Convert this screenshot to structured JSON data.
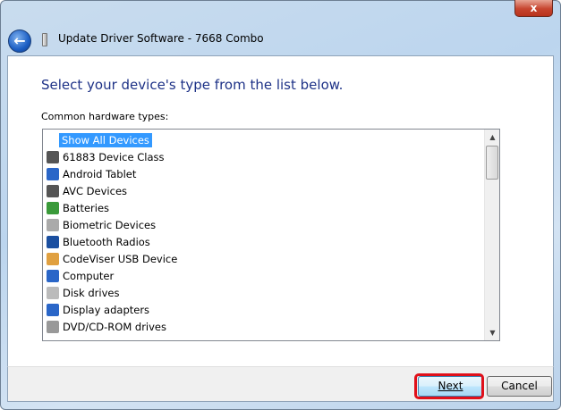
{
  "window": {
    "title": "Update Driver Software - 7668 Combo",
    "close_label": "x"
  },
  "heading": "Select your device's type from the list below.",
  "list_label": "Common hardware types:",
  "items": [
    {
      "label": "Show All Devices",
      "icon": "none",
      "selected": true
    },
    {
      "label": "61883 Device Class",
      "icon": "usb-plug-icon"
    },
    {
      "label": "Android Tablet",
      "icon": "monitor-icon"
    },
    {
      "label": "AVC Devices",
      "icon": "usb-plug-icon"
    },
    {
      "label": "Batteries",
      "icon": "battery-icon"
    },
    {
      "label": "Biometric Devices",
      "icon": "fingerprint-icon"
    },
    {
      "label": "Bluetooth Radios",
      "icon": "bluetooth-icon"
    },
    {
      "label": "CodeViser USB Device",
      "icon": "gear-icon"
    },
    {
      "label": "Computer",
      "icon": "computer-icon"
    },
    {
      "label": "Disk drives",
      "icon": "disk-drive-icon"
    },
    {
      "label": "Display adapters",
      "icon": "monitor-icon"
    },
    {
      "label": "DVD/CD-ROM drives",
      "icon": "dvd-drive-icon"
    }
  ],
  "buttons": {
    "next": "Next",
    "cancel": "Cancel"
  },
  "colors": {
    "heading": "#1e3287",
    "selection": "#3399ff",
    "highlight": "#e0101a"
  }
}
